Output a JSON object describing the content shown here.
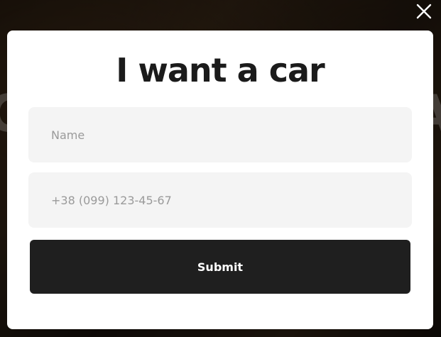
{
  "background": {
    "overlay_color": "#000000"
  },
  "close_icon": "close-icon",
  "modal": {
    "title": "I want a car",
    "name_field": {
      "value": "",
      "placeholder": "Name"
    },
    "phone_field": {
      "value": "",
      "placeholder": "+38 (099) 123-45-67"
    },
    "submit_label": "Submit",
    "colors": {
      "modal_bg": "#ffffff",
      "field_bg": "#f4f4f4",
      "button_bg": "#1f1f1f",
      "button_text": "#ffffff",
      "title_text": "#1b1b1b"
    }
  }
}
